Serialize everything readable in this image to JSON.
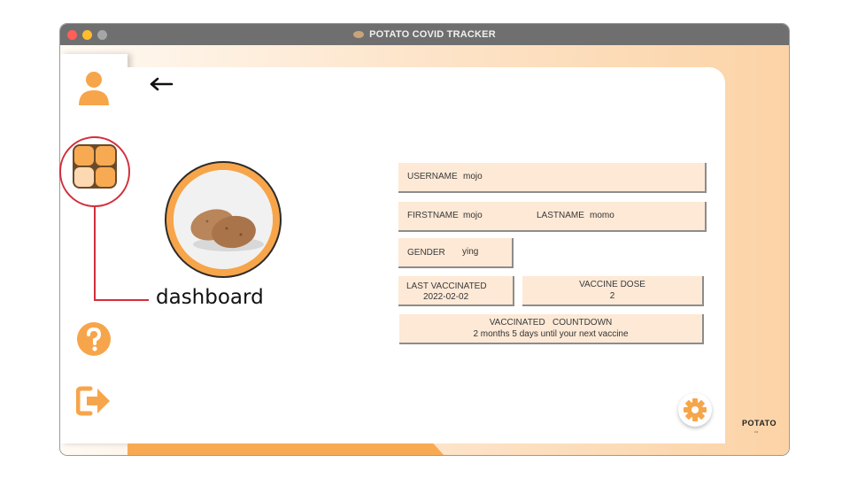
{
  "window": {
    "title": "POTATO COVID TRACKER"
  },
  "sidebar": {
    "items": [
      {
        "name": "profile",
        "icon": "user-icon"
      },
      {
        "name": "dashboard",
        "icon": "dashboard-grid-icon"
      },
      {
        "name": "help",
        "icon": "help-icon"
      },
      {
        "name": "logout",
        "icon": "logout-icon"
      }
    ]
  },
  "profile": {
    "username_label": "USERNAME",
    "username": "mojo",
    "firstname_label": "FIRSTNAME",
    "firstname": "mojo",
    "lastname_label": "LASTNAME",
    "lastname": "momo",
    "gender_label": "GENDER",
    "gender": "ying",
    "last_vaccinated_label": "LAST VACCINATED",
    "last_vaccinated": "2022-02-02",
    "vaccine_dose_label": "VACCINE DOSE",
    "vaccine_dose": "2",
    "countdown_label": "VACCINATED   COUNTDOWN",
    "countdown_text": "2 months 5 days until your next vaccine"
  },
  "brand": {
    "logo_text": "POTATO"
  },
  "annotation": {
    "label": "dashboard"
  },
  "colors": {
    "accent": "#f8aa53",
    "field_bg": "#fde9d6",
    "callout": "#d22f3b",
    "titlebar": "#6f6f6f"
  }
}
